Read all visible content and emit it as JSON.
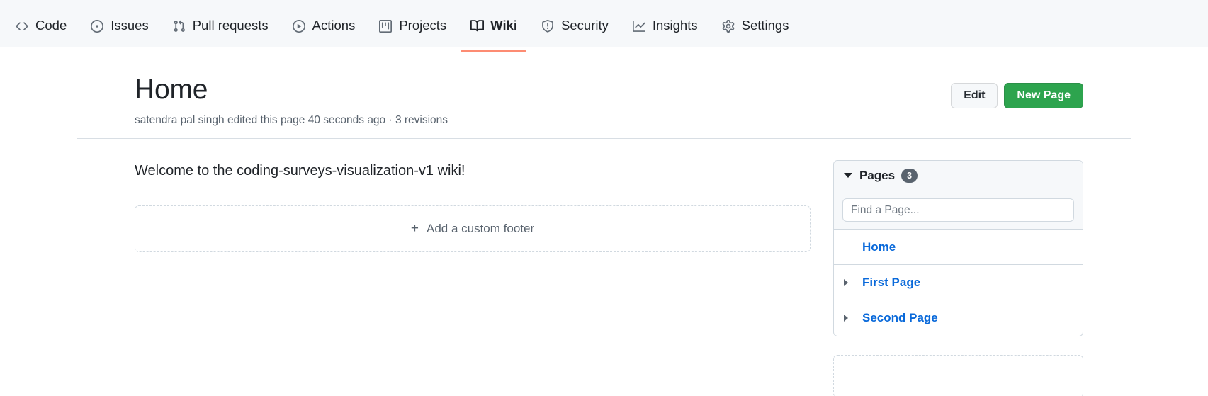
{
  "nav": {
    "items": [
      {
        "label": "Code",
        "icon": "code-icon",
        "active": false
      },
      {
        "label": "Issues",
        "icon": "issue-opened-icon",
        "active": false
      },
      {
        "label": "Pull requests",
        "icon": "git-pull-request-icon",
        "active": false
      },
      {
        "label": "Actions",
        "icon": "play-icon",
        "active": false
      },
      {
        "label": "Projects",
        "icon": "project-icon",
        "active": false
      },
      {
        "label": "Wiki",
        "icon": "book-icon",
        "active": true
      },
      {
        "label": "Security",
        "icon": "shield-icon",
        "active": false
      },
      {
        "label": "Insights",
        "icon": "graph-icon",
        "active": false
      },
      {
        "label": "Settings",
        "icon": "gear-icon",
        "active": false
      }
    ],
    "active_underline_color": "#fd8c73"
  },
  "header": {
    "title": "Home",
    "meta": "satendra pal singh edited this page 40 seconds ago · 3 revisions",
    "edit_label": "Edit",
    "new_page_label": "New Page",
    "primary_color": "#2da44e"
  },
  "main": {
    "welcome_text": "Welcome to the coding-surveys-visualization-v1 wiki!",
    "footer_cta_label": "Add a custom footer",
    "footer_cta_plus": "+"
  },
  "sidebar": {
    "pages_label": "Pages",
    "pages_count": "3",
    "search_placeholder": "Find a Page...",
    "search_value": "",
    "pages": [
      {
        "label": "Home",
        "expandable": false
      },
      {
        "label": "First Page",
        "expandable": true
      },
      {
        "label": "Second Page",
        "expandable": true
      }
    ],
    "link_color": "#0969da"
  }
}
